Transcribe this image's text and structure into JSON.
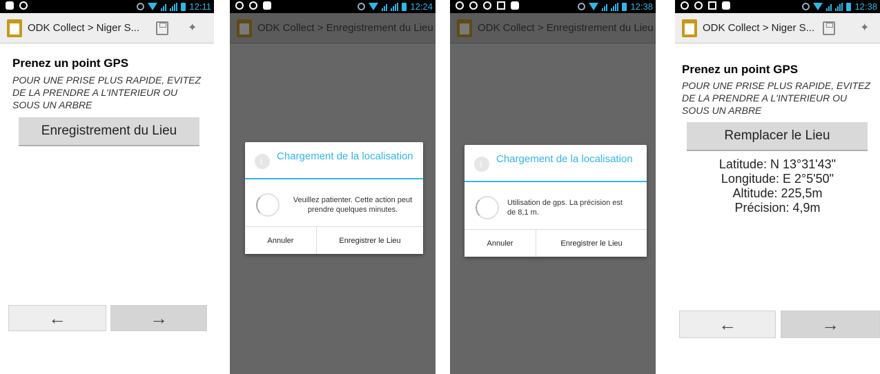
{
  "app_title_short": "ODK Collect > Niger S...",
  "app_title_long": "ODK Collect > Enregistrement du Lieu",
  "status_times": [
    "12:11",
    "12:24",
    "12:38",
    "12:38"
  ],
  "question": {
    "title": "Prenez un point GPS",
    "hint": "POUR UNE PRISE PLUS RAPIDE, EVITEZ DE LA PRENDRE A L'INTERIEUR OU SOUS UN ARBRE"
  },
  "record_button": "Enregistrement du Lieu",
  "replace_button": "Remplacer le Lieu",
  "nav": {
    "back": "←",
    "forward": "→"
  },
  "dialog": {
    "title": "Chargement de la localisation",
    "msg_waiting": "Veuillez patienter. Cette action peut prendre quelques minutes.",
    "msg_gps": "Utilisation de gps. La précision est de 8,1 m.",
    "cancel": "Annuler",
    "record": "Enregistrer le Lieu"
  },
  "gps_result": {
    "latitude": "Latitude: N 13°31'43\"",
    "longitude": "Longitude: E 2°5'50\"",
    "altitude": "Altitude: 225,5m",
    "precision": "Précision: 4,9m"
  },
  "colors": {
    "accent": "#33b5e5",
    "dim": "#666666",
    "app_icon": "#c8981c"
  }
}
